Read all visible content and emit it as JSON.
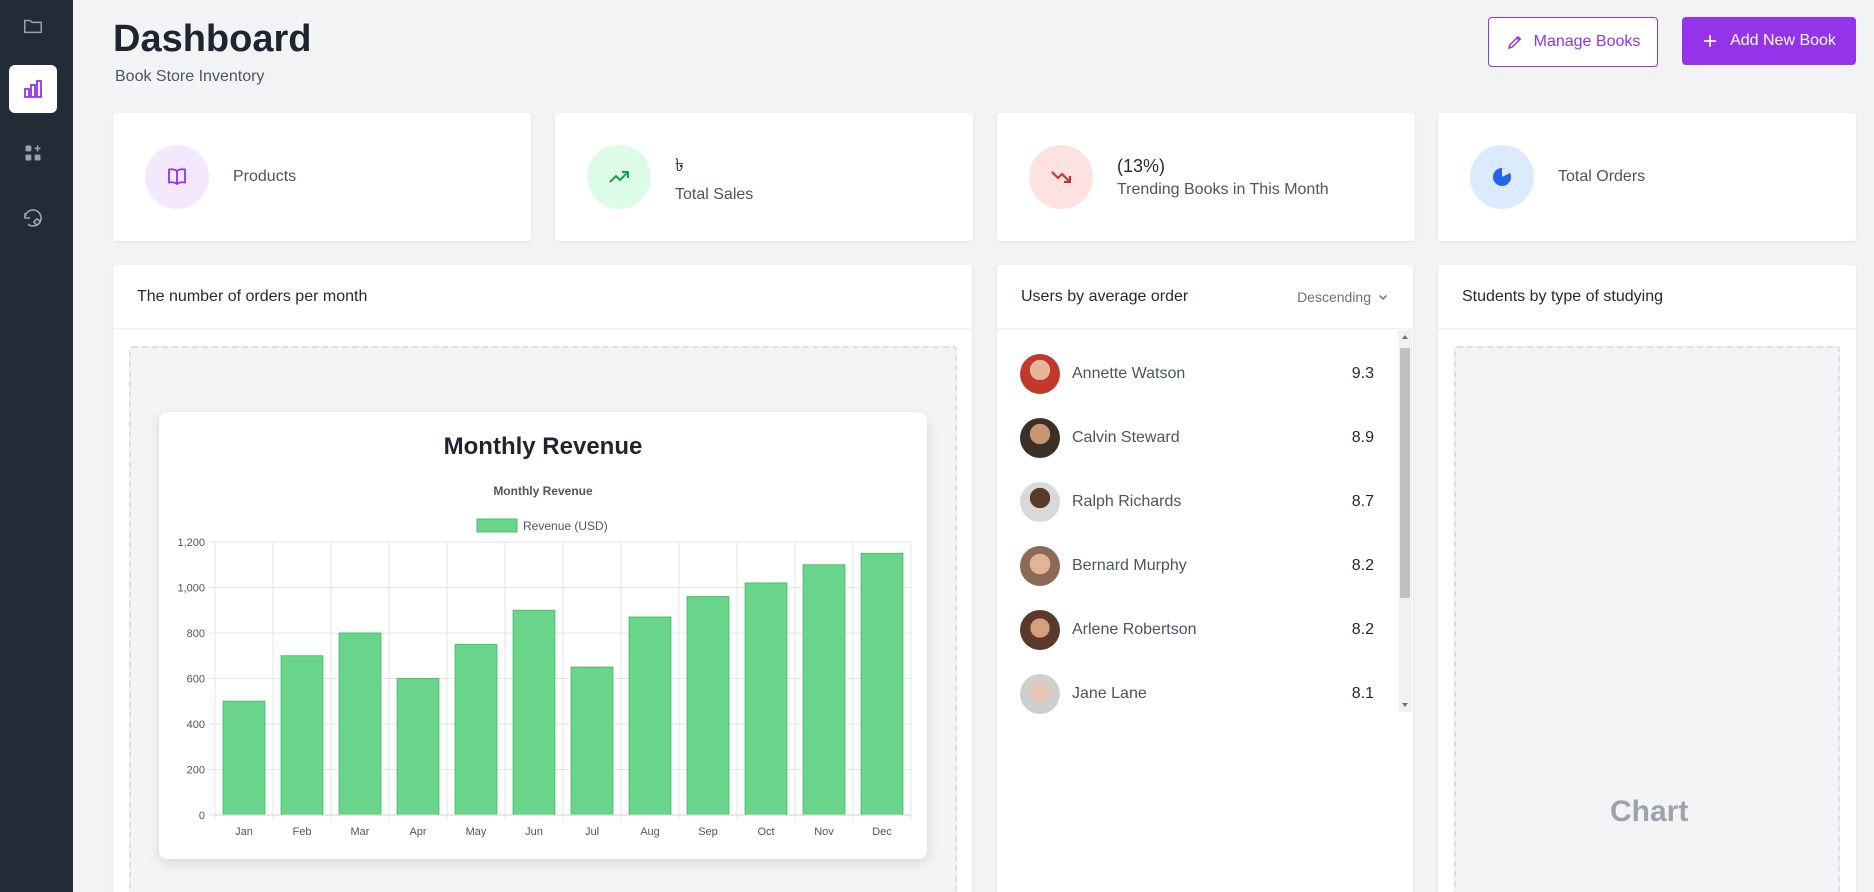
{
  "header": {
    "title": "Dashboard",
    "subtitle": "Book Store Inventory",
    "manage_label": "Manage Books",
    "add_label": "Add New Book"
  },
  "sidebar": {
    "items": [
      {
        "icon": "folder-icon"
      },
      {
        "icon": "bar-chart-icon",
        "active": true
      },
      {
        "icon": "apps-add-icon"
      },
      {
        "icon": "settings-history-icon"
      }
    ]
  },
  "stats": [
    {
      "icon": "book-icon",
      "value": "",
      "label": "Products",
      "color": "#9333ea",
      "bg": "#f3e8ff"
    },
    {
      "icon": "trending-up-icon",
      "value": "৳",
      "label": "Total Sales",
      "color": "#16a34a",
      "bg": "#dcfce7"
    },
    {
      "icon": "trending-down-icon",
      "value": "(13%)",
      "label": "Trending Books in This Month",
      "color": "#dc2626",
      "bg": "#fee2e2"
    },
    {
      "icon": "pie-icon",
      "value": "",
      "label": "Total Orders",
      "color": "#2563eb",
      "bg": "#dbeafe"
    }
  ],
  "orders_panel": {
    "title": "The number of orders per month"
  },
  "users_panel": {
    "title": "Users by average order",
    "sort_label": "Descending",
    "users": [
      {
        "name": "Annette Watson",
        "score": "9.3"
      },
      {
        "name": "Calvin Steward",
        "score": "8.9"
      },
      {
        "name": "Ralph Richards",
        "score": "8.7"
      },
      {
        "name": "Bernard Murphy",
        "score": "8.2"
      },
      {
        "name": "Arlene Robertson",
        "score": "8.2"
      },
      {
        "name": "Jane Lane",
        "score": "8.1"
      }
    ]
  },
  "students_panel": {
    "title": "Students by type of studying",
    "placeholder": "Chart"
  },
  "chart_data": {
    "type": "bar",
    "card_title": "Monthly Revenue",
    "title": "Monthly Revenue",
    "categories": [
      "Jan",
      "Feb",
      "Mar",
      "Apr",
      "May",
      "Jun",
      "Jul",
      "Aug",
      "Sep",
      "Oct",
      "Nov",
      "Dec"
    ],
    "series": [
      {
        "name": "Revenue (USD)",
        "values": [
          500,
          700,
          800,
          600,
          750,
          900,
          650,
          870,
          960,
          1020,
          1100,
          1150
        ],
        "color": "#68d58a"
      }
    ],
    "yticks": [
      "0",
      "200",
      "400",
      "600",
      "800",
      "1,000",
      "1,200"
    ],
    "ylim": [
      0,
      1200
    ],
    "grid": true,
    "legend": "top"
  }
}
